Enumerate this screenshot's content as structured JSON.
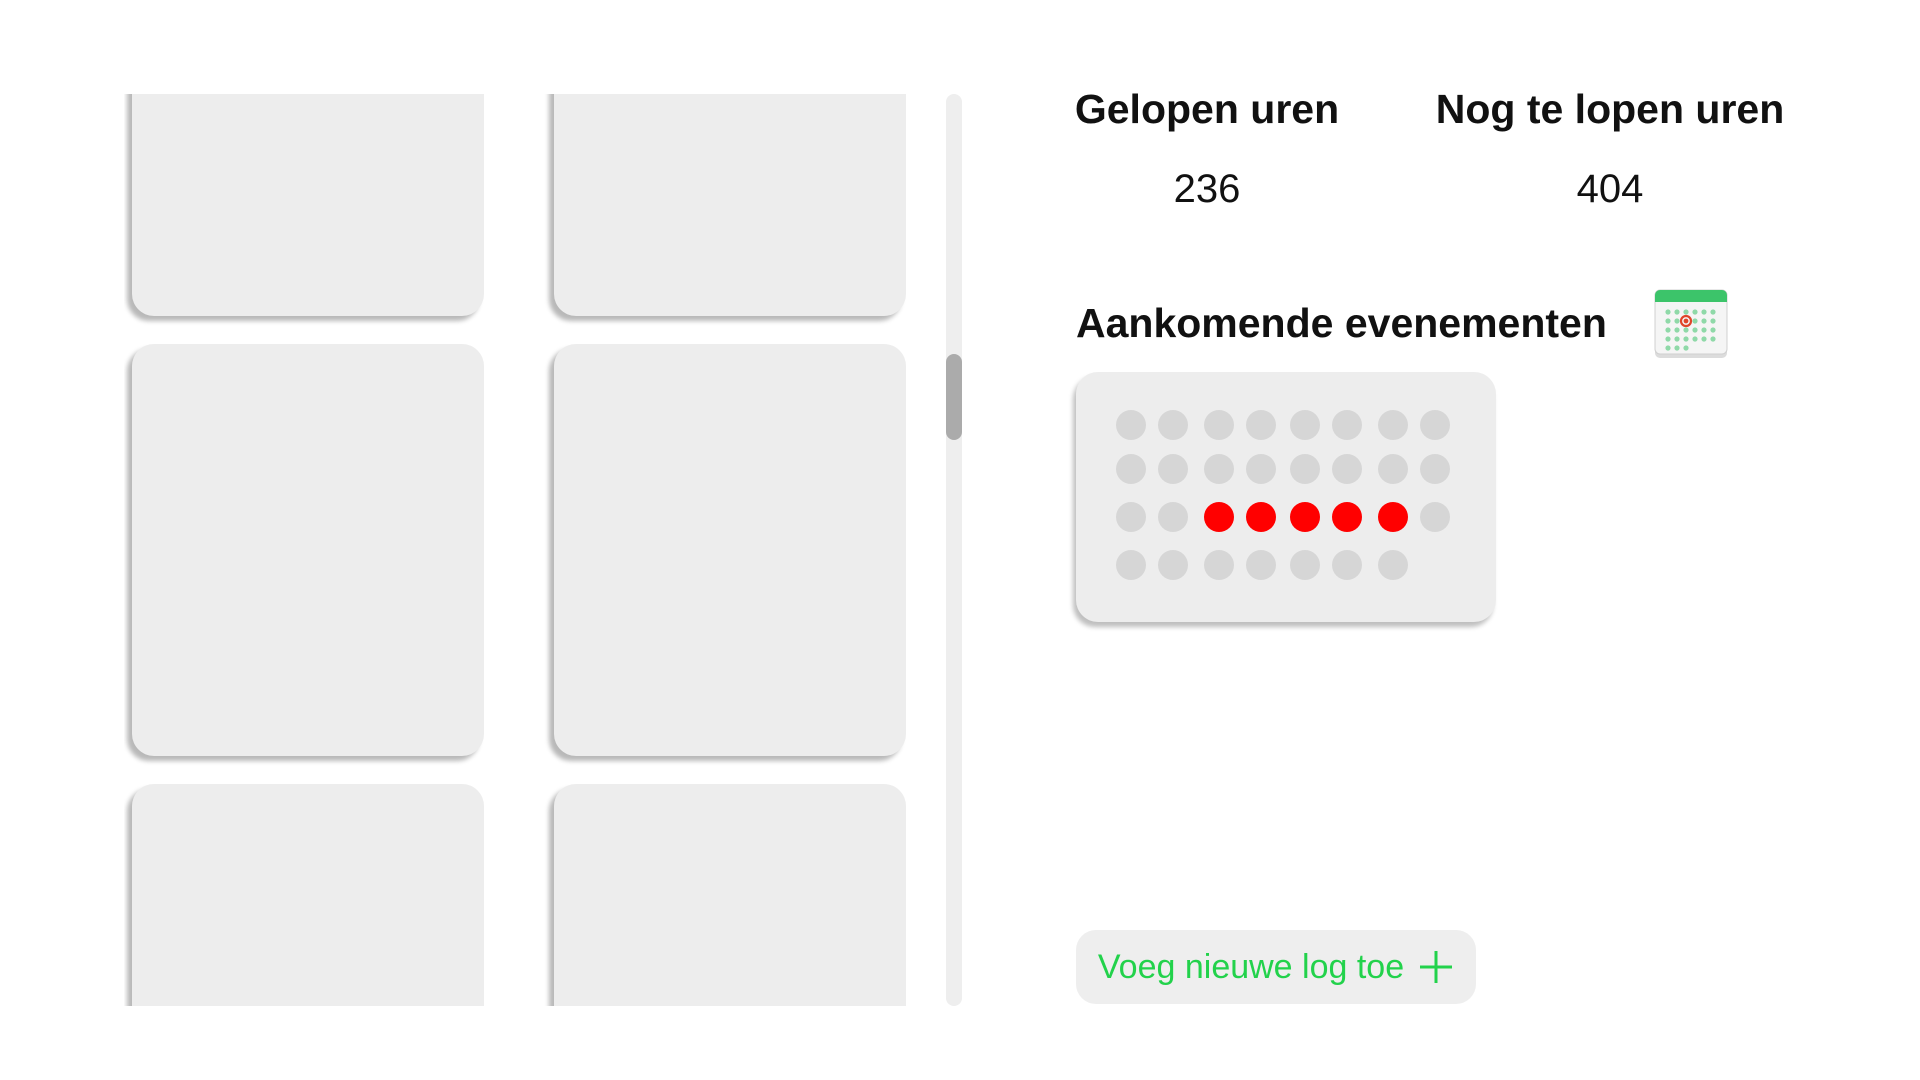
{
  "stats": {
    "walked_label": "Gelopen uren",
    "walked_value": "236",
    "remaining_label": "Nog te lopen uren",
    "remaining_value": "404"
  },
  "events": {
    "title": "Aankomende evenementen",
    "icon": "calendar-icon",
    "dot_rows": [
      [
        false,
        false,
        false,
        false,
        false,
        false,
        false,
        false
      ],
      [
        false,
        false,
        false,
        false,
        false,
        false,
        false,
        false
      ],
      [
        false,
        false,
        true,
        true,
        true,
        true,
        true,
        false
      ],
      [
        false,
        false,
        false,
        false,
        false,
        false,
        false
      ]
    ]
  },
  "actions": {
    "add_log_label": "Voeg nieuwe log toe",
    "add_log_icon": "plus-icon"
  },
  "colors": {
    "accent_green": "#22d24b",
    "event_red": "#ff0000",
    "card_bg": "#ededed",
    "dot_inactive": "#d6d6d6"
  }
}
